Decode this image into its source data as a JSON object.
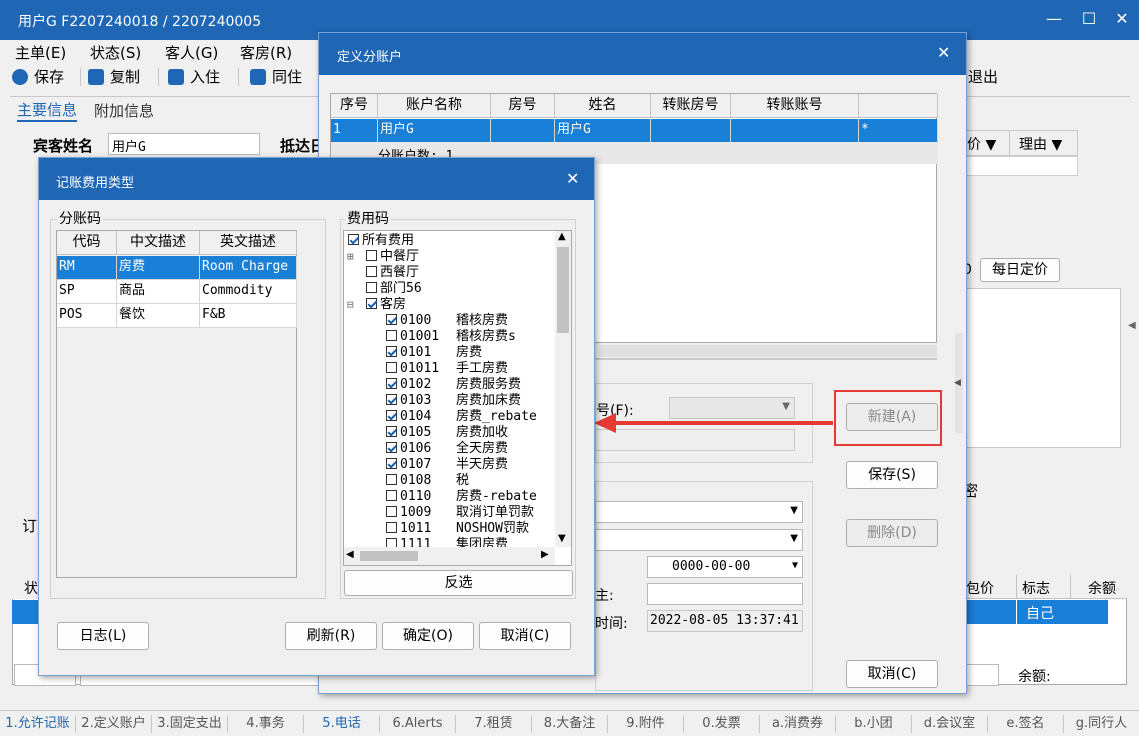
{
  "window": {
    "title": "用户G  F2207240018 / 2207240005"
  },
  "menu": [
    "主单(E)",
    "状态(S)",
    "客人(G)",
    "客房(R)"
  ],
  "toolbar": {
    "save": "保存",
    "copy": "复制",
    "checkin": "入住",
    "share": "同住",
    "exit": "退出"
  },
  "tabs": {
    "main": "主要信息",
    "extra": "附加信息"
  },
  "guest": {
    "name_label": "宾客姓名",
    "name_value": "用户G",
    "arrive_label": "抵达日"
  },
  "right_panel": {
    "price_header": "价 ▼",
    "reason_header": "理由 ▼",
    "daily_price": "每日定价",
    "small_zero": "0",
    "pwd": "密"
  },
  "bottom_grid": {
    "status_header": "状",
    "flag_header": "标志",
    "balance_header": "余额",
    "price_header": "包价",
    "flag_value": "自己",
    "balance_label": "余额:",
    "order_label": "订"
  },
  "status_tabs": [
    "1.允许记账",
    "2.定义账户",
    "3.固定支出",
    "4.事务",
    "5.电话",
    "6.Alerts",
    "7.租赁",
    "8.大备注",
    "9.附件",
    "0.发票",
    "a.消费券",
    "b.小团",
    "d.会议室",
    "e.签名",
    "g.同行人"
  ],
  "define_dialog": {
    "title": "定义分账户",
    "columns": [
      "序号",
      "账户名称",
      "房号",
      "姓名",
      "转账房号",
      "转账账号"
    ],
    "row": {
      "seq": "1",
      "name": "用户G",
      "room": "",
      "guest": "用户G",
      "trans_room": "",
      "trans_acct": "",
      "flag": "*"
    },
    "count_text": "分账户数: 1",
    "fee_label": "号(F):",
    "datetime_label": "时间:",
    "date_value": "0000-00-00",
    "time_value": "2022-08-05 13:37:41",
    "e_label": "主:",
    "buttons": {
      "new": "新建(A)",
      "save": "保存(S)",
      "delete": "删除(D)",
      "cancel": "取消(C)"
    }
  },
  "fee_dialog": {
    "title": "记账费用类型",
    "sub_group": "分账码",
    "fee_group": "费用码",
    "sub_columns": [
      "代码",
      "中文描述",
      "英文描述"
    ],
    "sub_rows": [
      {
        "code": "RM",
        "cn": "房费",
        "en": "Room Charge"
      },
      {
        "code": "SP",
        "cn": "商品",
        "en": "Commodity"
      },
      {
        "code": "POS",
        "cn": "餐饮",
        "en": "F&B"
      }
    ],
    "tree": [
      {
        "label": "所有费用",
        "checked": true,
        "level": 0
      },
      {
        "label": "中餐厅",
        "checked": false,
        "level": 1,
        "expand": "+"
      },
      {
        "label": "西餐厅",
        "checked": false,
        "level": 1
      },
      {
        "label": "部门56",
        "checked": false,
        "level": 1
      },
      {
        "label": "客房",
        "checked": true,
        "level": 1,
        "expand": "-"
      },
      {
        "code": "0100",
        "label": "稽核房费",
        "checked": true,
        "level": 2
      },
      {
        "code": "01001",
        "label": "稽核房费s",
        "checked": false,
        "level": 2
      },
      {
        "code": "0101",
        "label": "房费",
        "checked": true,
        "level": 2
      },
      {
        "code": "01011",
        "label": "手工房费",
        "checked": false,
        "level": 2
      },
      {
        "code": "0102",
        "label": "房费服务费",
        "checked": true,
        "level": 2
      },
      {
        "code": "0103",
        "label": "房费加床费",
        "checked": true,
        "level": 2
      },
      {
        "code": "0104",
        "label": "房费_rebate",
        "checked": true,
        "level": 2
      },
      {
        "code": "0105",
        "label": "房费加收",
        "checked": true,
        "level": 2
      },
      {
        "code": "0106",
        "label": "全天房费",
        "checked": true,
        "level": 2
      },
      {
        "code": "0107",
        "label": "半天房费",
        "checked": true,
        "level": 2
      },
      {
        "code": "0108",
        "label": "税",
        "checked": false,
        "level": 2
      },
      {
        "code": "0110",
        "label": "房费-rebate",
        "checked": false,
        "level": 2
      },
      {
        "code": "1009",
        "label": "取消订单罚款",
        "checked": false,
        "level": 2
      },
      {
        "code": "1011",
        "label": "NOSHOW罚款",
        "checked": false,
        "level": 2
      },
      {
        "code": "1111",
        "label": "集团房费",
        "checked": false,
        "level": 2
      }
    ],
    "buttons": {
      "invert": "反选",
      "log": "日志(L)",
      "refresh": "刷新(R)",
      "ok": "确定(O)",
      "cancel": "取消(C)"
    }
  }
}
